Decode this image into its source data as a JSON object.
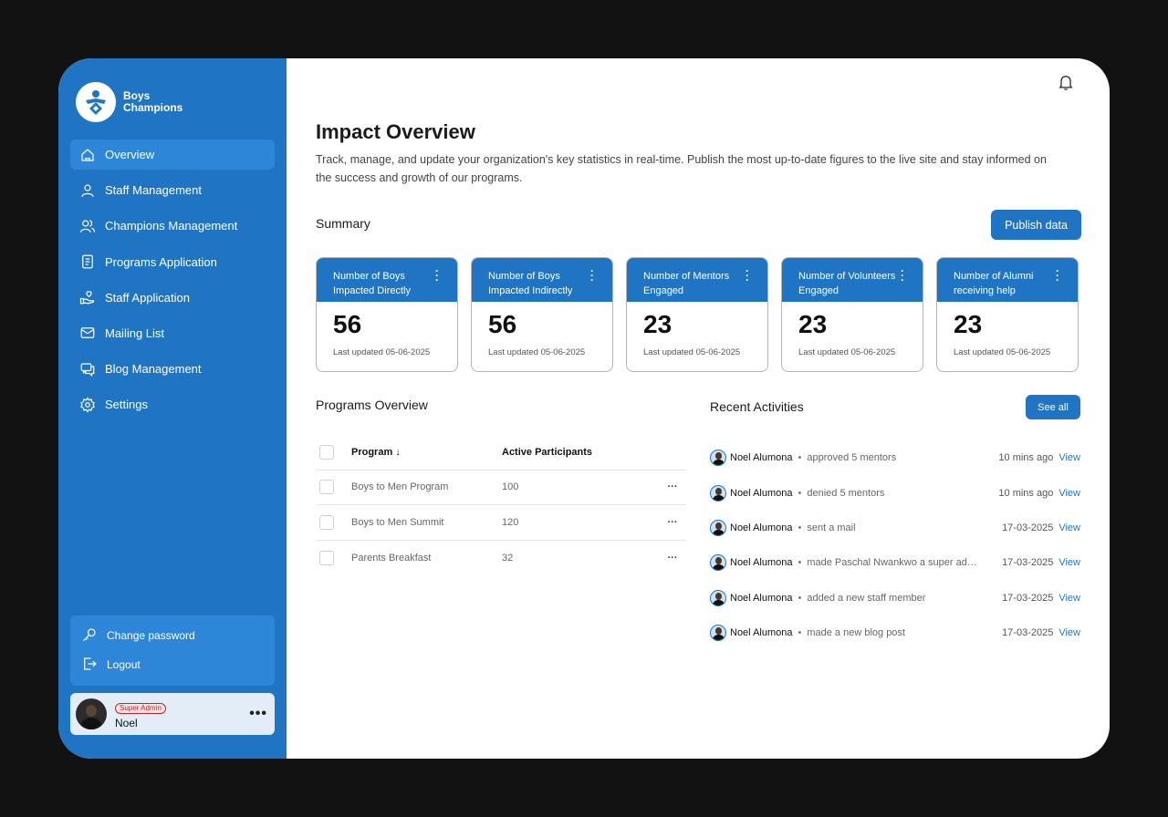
{
  "brand": {
    "name_line1": "Boys",
    "name_line2": "Champions"
  },
  "sidebar": {
    "items": [
      {
        "label": "Overview",
        "icon": "home-icon",
        "active": true
      },
      {
        "label": "Staff Management",
        "icon": "user-icon"
      },
      {
        "label": "Champions Management",
        "icon": "users-icon"
      },
      {
        "label": "Programs Application",
        "icon": "document-icon"
      },
      {
        "label": "Staff Application",
        "icon": "hand-heart-icon"
      },
      {
        "label": "Mailing List",
        "icon": "mail-icon"
      },
      {
        "label": "Blog Management",
        "icon": "chat-icon"
      },
      {
        "label": "Settings",
        "icon": "gear-icon"
      }
    ],
    "account": {
      "change_password": "Change password",
      "logout": "Logout"
    },
    "user": {
      "role": "Super Admin",
      "name": "Noel",
      "more": "•••"
    }
  },
  "header": {
    "title": "Impact Overview",
    "description": "Track, manage, and update your organization's key statistics in real-time. Publish the most up-to-date figures to the live site and stay informed on the success and growth of our programs."
  },
  "summary": {
    "title": "Summary",
    "publish_label": "Publish data",
    "cards": [
      {
        "title": "Number of Boys Impacted Directly",
        "value": "56",
        "updated": "Last updated 05-06-2025"
      },
      {
        "title": "Number of Boys Impacted Indirectly",
        "value": "56",
        "updated": "Last updated 05-06-2025"
      },
      {
        "title": "Number of Mentors Engaged",
        "value": "23",
        "updated": "Last updated 05-06-2025"
      },
      {
        "title": "Number of Volunteers Engaged",
        "value": "23",
        "updated": "Last updated 05-06-2025"
      },
      {
        "title": "Number of Alumni receiving help",
        "value": "23",
        "updated": "Last updated 05-06-2025"
      }
    ]
  },
  "programs": {
    "title": "Programs Overview",
    "headers": {
      "program": "Program",
      "sort_arrow": "↓",
      "participants": "Active Participants"
    },
    "rows": [
      {
        "program": "Boys to Men Program",
        "participants": "100",
        "menu": "···"
      },
      {
        "program": "Boys to Men Summit",
        "participants": "120",
        "menu": "···"
      },
      {
        "program": "Parents Breakfast",
        "participants": "32",
        "menu": "···"
      }
    ]
  },
  "activities": {
    "title": "Recent Activities",
    "see_all": "See all",
    "items": [
      {
        "name": "Noel Alumona",
        "action": "approved 5 mentors",
        "time": "10 mins ago",
        "link": "View"
      },
      {
        "name": "Noel Alumona",
        "action": "denied 5 mentors",
        "time": "10 mins ago",
        "link": "View"
      },
      {
        "name": "Noel Alumona",
        "action": "sent a mail",
        "time": "17-03-2025",
        "link": "View"
      },
      {
        "name": "Noel Alumona",
        "action": "made Paschal Nwankwo a super admin",
        "time": "17-03-2025",
        "link": "View"
      },
      {
        "name": "Noel Alumona",
        "action": "added a new staff member",
        "time": "17-03-2025",
        "link": "View"
      },
      {
        "name": "Noel Alumona",
        "action": "made a new blog post",
        "time": "17-03-2025",
        "link": "View"
      }
    ]
  },
  "colors": {
    "primary": "#1f75c4",
    "sidebar_active": "#2d86d8",
    "badge": "#c0272d"
  }
}
